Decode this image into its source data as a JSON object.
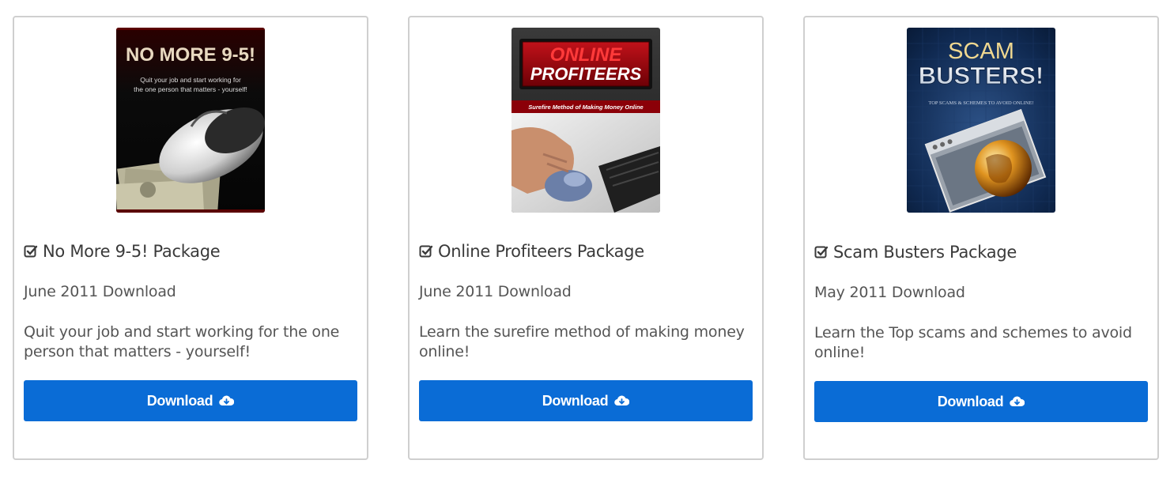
{
  "packages": [
    {
      "title": "No More 9-5! Package",
      "date": "June 2011 Download",
      "description": "Quit your job and start working for the one person that matters - yourself!",
      "button_label": "Download",
      "cover": {
        "headline": "NO MORE 9-5!",
        "tagline_1": "Quit your job and start working for",
        "tagline_2": "the one person that matters - yourself!"
      }
    },
    {
      "title": "Online Profiteers Package",
      "date": "June 2011 Download",
      "description": "Learn the surefire method of making money online!",
      "button_label": "Download",
      "cover": {
        "headline_1": "ONLINE",
        "headline_2": "PROFITEERS",
        "tagline": "Surefire Method of Making Money Online"
      }
    },
    {
      "title": "Scam Busters Package",
      "date": "May 2011 Download",
      "description": "Learn the Top scams and schemes to avoid online!",
      "button_label": "Download",
      "cover": {
        "headline_1": "SCAM",
        "headline_2": "BUSTERS!",
        "tagline": "TOP SCAMS & SCHEMES TO AVOID ONLINE!"
      }
    }
  ],
  "icons": {
    "title": "check-square-icon",
    "button": "cloud-download-icon"
  },
  "colors": {
    "button": "#0a6cd6",
    "card_border": "#cfcfcf"
  }
}
